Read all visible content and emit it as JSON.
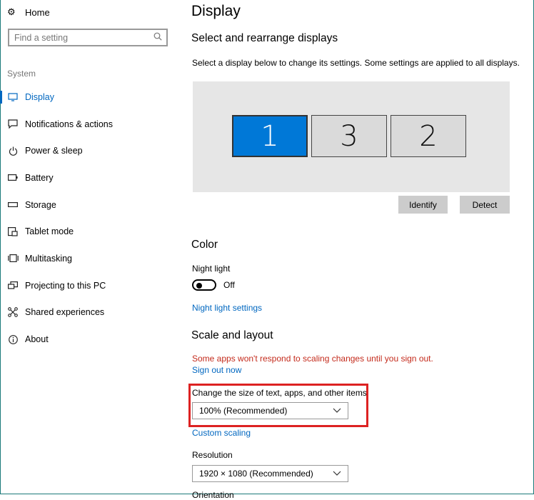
{
  "sidebar": {
    "home_label": "Home",
    "search_placeholder": "Find a setting",
    "section_label": "System",
    "items": [
      {
        "label": "Display",
        "icon": "monitor-icon"
      },
      {
        "label": "Notifications & actions",
        "icon": "notification-icon"
      },
      {
        "label": "Power & sleep",
        "icon": "power-icon"
      },
      {
        "label": "Battery",
        "icon": "battery-icon"
      },
      {
        "label": "Storage",
        "icon": "storage-icon"
      },
      {
        "label": "Tablet mode",
        "icon": "tablet-mode-icon"
      },
      {
        "label": "Multitasking",
        "icon": "multitasking-icon"
      },
      {
        "label": "Projecting to this PC",
        "icon": "projecting-icon"
      },
      {
        "label": "Shared experiences",
        "icon": "shared-experiences-icon"
      },
      {
        "label": "About",
        "icon": "info-icon"
      }
    ],
    "active_index": 0
  },
  "main": {
    "title": "Display",
    "arrange": {
      "heading": "Select and rearrange displays",
      "description": "Select a display below to change its settings. Some settings are applied to all displays.",
      "monitors": [
        "1",
        "3",
        "2"
      ],
      "selected_monitor": "1",
      "identify_label": "Identify",
      "detect_label": "Detect"
    },
    "color": {
      "heading": "Color",
      "night_light_label": "Night light",
      "night_light_state": "Off",
      "night_light_settings_link": "Night light settings"
    },
    "scale": {
      "heading": "Scale and layout",
      "warning": "Some apps won't respond to scaling changes until you sign out.",
      "sign_out_link": "Sign out now",
      "size_label": "Change the size of text, apps, and other items",
      "size_value": "100% (Recommended)",
      "custom_scaling_link": "Custom scaling",
      "resolution_label": "Resolution",
      "resolution_value": "1920 × 1080 (Recommended)",
      "orientation_label_partial": "Orientation"
    }
  },
  "colors": {
    "accent": "#0078d7",
    "link": "#0067c0",
    "warning": "#c42b1c",
    "highlight_box": "#dd2222"
  }
}
